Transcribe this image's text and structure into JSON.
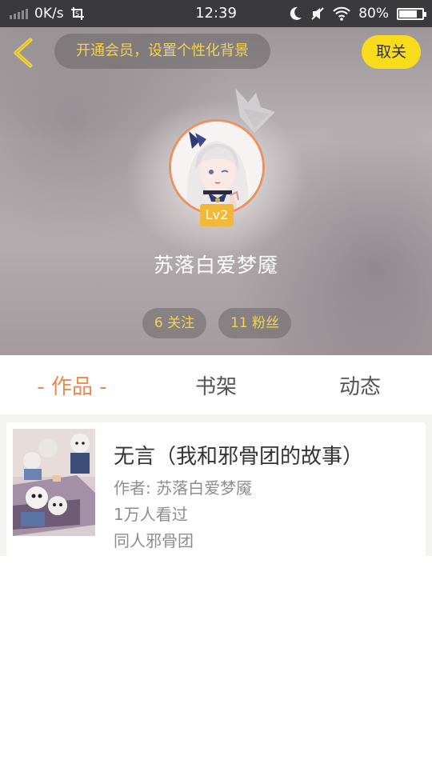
{
  "status_bar": {
    "net_speed": "0K/s",
    "time": "12:39",
    "battery_percent": "80%",
    "battery_level": 0.8,
    "icons": [
      "signal-icon",
      "screenshot-icon",
      "moon-icon",
      "mute-icon",
      "wifi-icon",
      "battery-icon"
    ]
  },
  "header": {
    "back_icon": "chevron-left-icon",
    "vip_banner": "开通会员，设置个性化背景",
    "unfollow_button": "取关",
    "crown_icon": "crown-icon",
    "level": "Lv2",
    "username": "苏落白爱梦魇",
    "following": "6 关注",
    "fans": "11 粉丝"
  },
  "tabs": [
    {
      "label": "作品",
      "active": true
    },
    {
      "label": "书架",
      "active": false
    },
    {
      "label": "动态",
      "active": false
    }
  ],
  "active_tab_dash": "-",
  "works": [
    {
      "title": "无言（我和邪骨团的故事）",
      "author": "作者: 苏落白爱梦魇",
      "views": "1万人看过",
      "category": "同人邪骨团"
    }
  ],
  "colors": {
    "accent": "#f0864a",
    "yellow": "#f8dc1c",
    "badge": "#f2b83a",
    "status_bar": "#3a3a3c"
  }
}
